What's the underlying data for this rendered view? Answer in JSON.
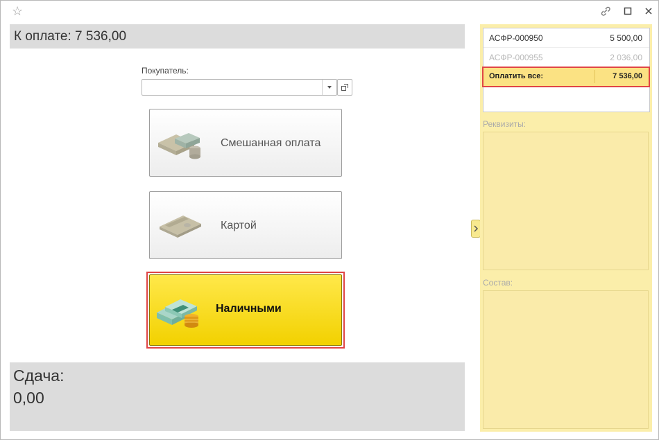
{
  "window": {
    "star_icon": "star-icon",
    "link_icon": "link-icon",
    "maximize_icon": "maximize-icon",
    "close_icon": "close-icon"
  },
  "payment": {
    "to_pay": "К оплате: 7 536,00"
  },
  "buyer": {
    "label": "Покупатель:",
    "value": ""
  },
  "buttons": {
    "mixed": "Смешанная оплата",
    "card": "Картой",
    "cash": "Наличными"
  },
  "change": {
    "label": "Сдача:",
    "value": "0,00"
  },
  "documents": [
    {
      "name": "АСФР-000950",
      "amount": "5 500,00"
    },
    {
      "name": "АСФР-000955",
      "amount": "2 036,00"
    }
  ],
  "pay_all": {
    "label": "Оплатить все:",
    "amount": "7 536,00"
  },
  "sections": {
    "requisites": "Реквизиты:",
    "composition": "Состав:"
  },
  "colors": {
    "accent_yellow": "#f2d100",
    "panel_yellow": "#fbeeaa",
    "highlight_red": "#e04545"
  }
}
